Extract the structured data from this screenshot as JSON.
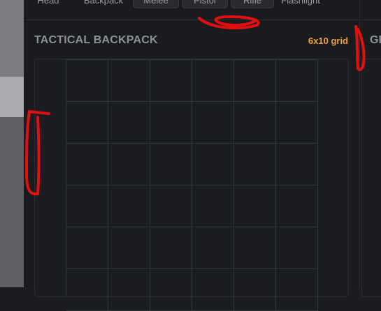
{
  "slot_tabs": [
    {
      "label": "Head"
    },
    {
      "label": "Backpack"
    },
    {
      "label": "Melee"
    },
    {
      "label": "Pistol"
    },
    {
      "label": "Rifle"
    },
    {
      "label": "Flashlight"
    }
  ],
  "backpack": {
    "title": "TACTICAL BACKPACK",
    "grid_size_label": "6x10 grid"
  },
  "next_panel": {
    "title": "GR"
  },
  "colors": {
    "accent": "#f0a33a",
    "annotation": "#e01010"
  }
}
